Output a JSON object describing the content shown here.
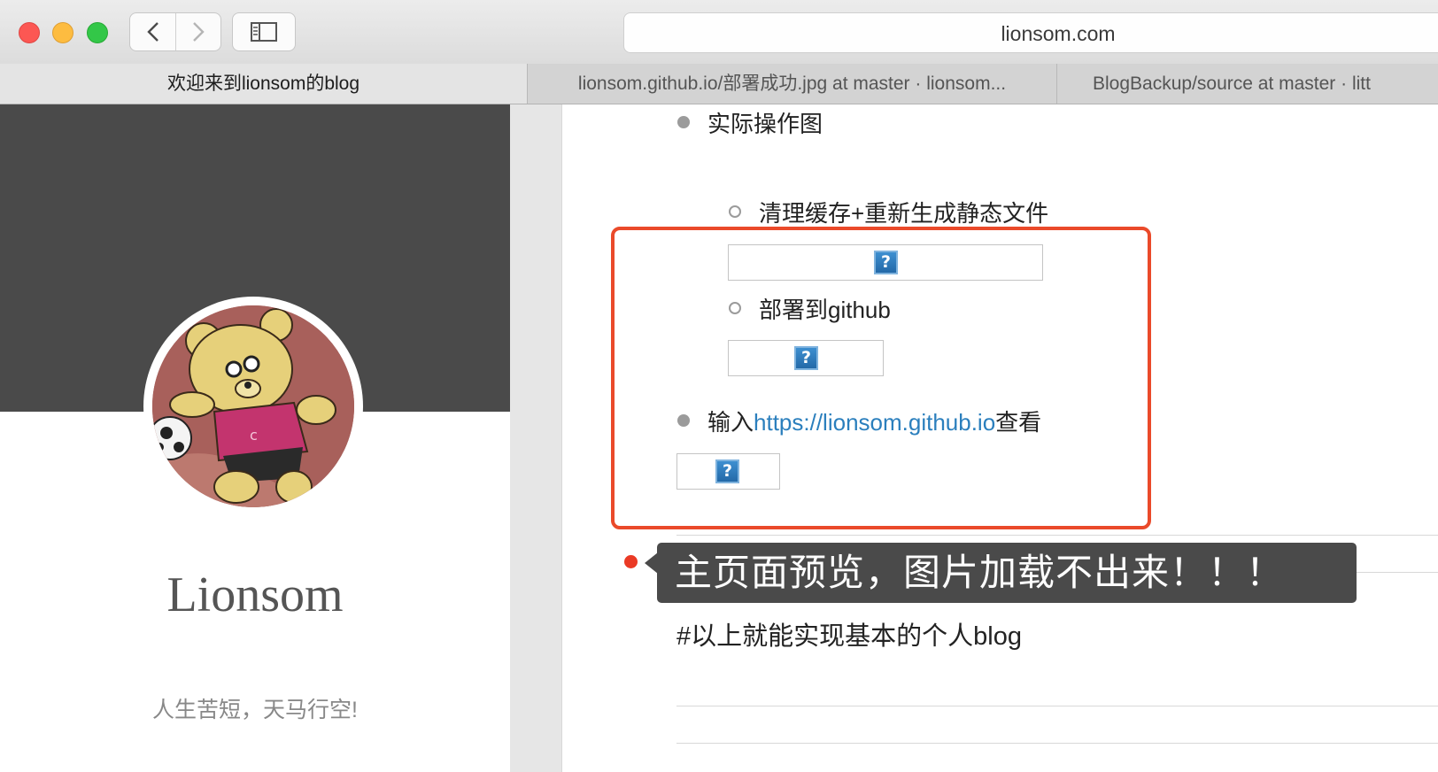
{
  "browser": {
    "url": "lionsom.com",
    "tabs": [
      {
        "label": "欢迎来到lionsom的blog",
        "active": true
      },
      {
        "label": "lionsom.github.io/部署成功.jpg at master · lionsom...",
        "active": false
      },
      {
        "label": "BlogBackup/source at master · litt",
        "active": false
      }
    ]
  },
  "sidebar": {
    "site_name": "Lionsom",
    "motto": "人生苦短，天马行空!"
  },
  "post": {
    "item_actual_screens": "实际操作图",
    "sub_item_clean": "清理缓存+重新生成静态文件",
    "sub_item_deploy": "部署到github",
    "item_visit_prefix": "输入",
    "item_visit_link": "https://lionsom.github.io",
    "item_visit_suffix": "查看",
    "broken_image_glyph": "?",
    "blog_line": "#以上就能实现基本的个人blog"
  },
  "annotation": {
    "text": "主页面预览，图片加载不出来！！！",
    "accent_color": "#ea4a2a"
  },
  "colors": {
    "banner": "#4a4a4a",
    "link": "#2b7fbd"
  },
  "icons": [
    "chevron-left-icon",
    "chevron-right-icon",
    "sidebar-toggle-icon",
    "broken-image-icon"
  ]
}
